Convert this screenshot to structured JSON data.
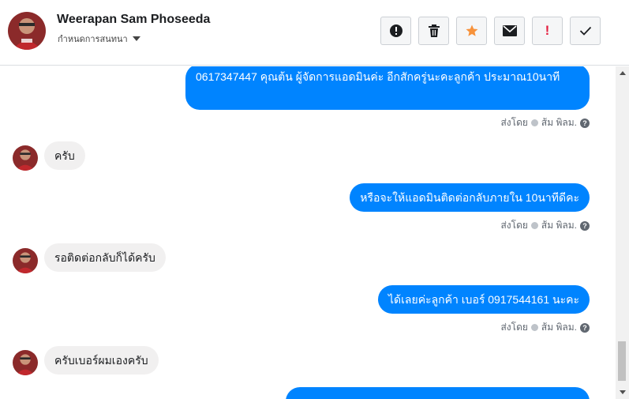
{
  "header": {
    "contact_name": "Weerapan Sam Phoseeda",
    "subtitle": "กำหนดการสนทนา",
    "toolbar": {
      "alert": "!",
      "delete": "trash-icon",
      "star": "star-icon",
      "mail": "envelope-icon",
      "spam": "!",
      "done": "check-icon"
    }
  },
  "colors": {
    "accent": "#0084ff",
    "star": "#f7923b",
    "spam": "#e41e3f"
  },
  "messages": [
    {
      "dir": "out",
      "text": "0617347447 คุณต้น ผู้จัดการแอดมินค่ะ อีกสักครู่นะคะลูกค้า ประมาณ10นาที",
      "sent_by": "ส่งโดย",
      "sender": "ส้ม พิลม.",
      "help": "?"
    },
    {
      "dir": "in",
      "text": "ครับ"
    },
    {
      "dir": "out",
      "text": "หรือจะให้แอดมินติดต่อกลับภายใน 10นาทีดีคะ",
      "sent_by": "ส่งโดย",
      "sender": "ส้ม พิลม.",
      "help": "?"
    },
    {
      "dir": "in",
      "text": "รอติดต่อกลับก็ได้ครับ"
    },
    {
      "dir": "out",
      "text": "ได้เลยค่ะลูกค้า เบอร์ 0917544161 นะคะ",
      "sent_by": "ส่งโดย",
      "sender": "ส้ม พิลม.",
      "help": "?"
    },
    {
      "dir": "in",
      "text": "ครับเบอร์ผมเองครับ"
    }
  ]
}
